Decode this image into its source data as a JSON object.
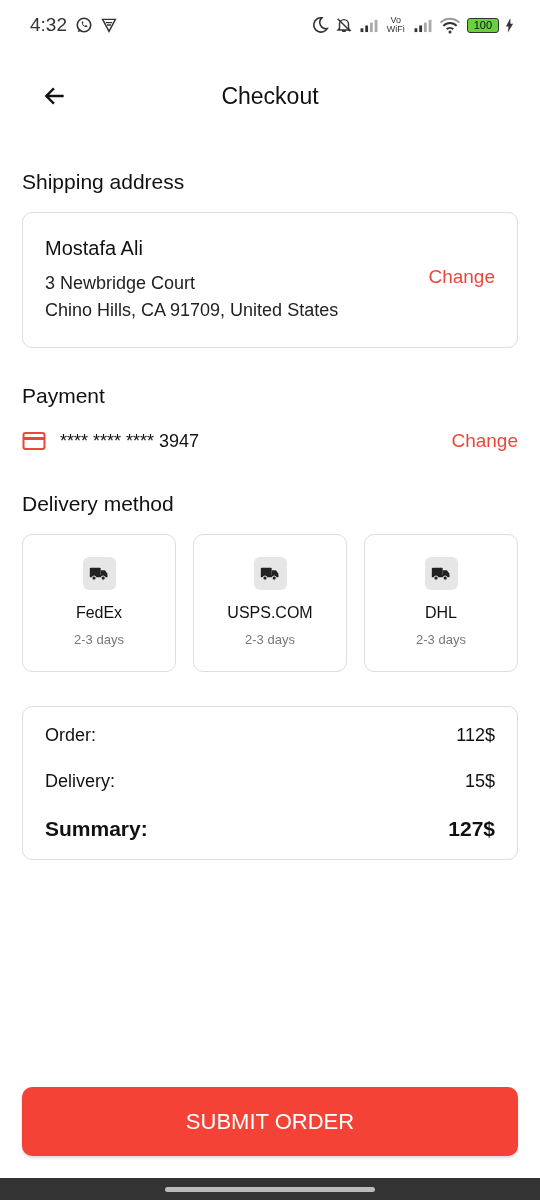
{
  "status_bar": {
    "time": "4:32",
    "vowifi": "Vo WiFi",
    "battery": "100"
  },
  "header": {
    "title": "Checkout"
  },
  "shipping": {
    "heading": "Shipping address",
    "name": "Mostafa Ali",
    "address_lines": [
      "3 Newbridge Court",
      "Chino Hills, CA 91709, United States"
    ],
    "action": "Change"
  },
  "payment": {
    "heading": "Payment",
    "card_number": "**** **** **** 3947",
    "action": "Change"
  },
  "delivery": {
    "heading": "Delivery method",
    "options": [
      {
        "name": "FedEx",
        "time": "2-3 days"
      },
      {
        "name": "USPS.COM",
        "time": "2-3 days"
      },
      {
        "name": "DHL",
        "time": "2-3 days"
      }
    ]
  },
  "summary": {
    "rows": [
      {
        "label": "Order:",
        "value": "112$",
        "kind": "line"
      },
      {
        "label": "Delivery:",
        "value": "15$",
        "kind": "line"
      },
      {
        "label": "Summary:",
        "value": "127$",
        "kind": "total"
      }
    ]
  },
  "submit_button": "SUBMIT ORDER"
}
